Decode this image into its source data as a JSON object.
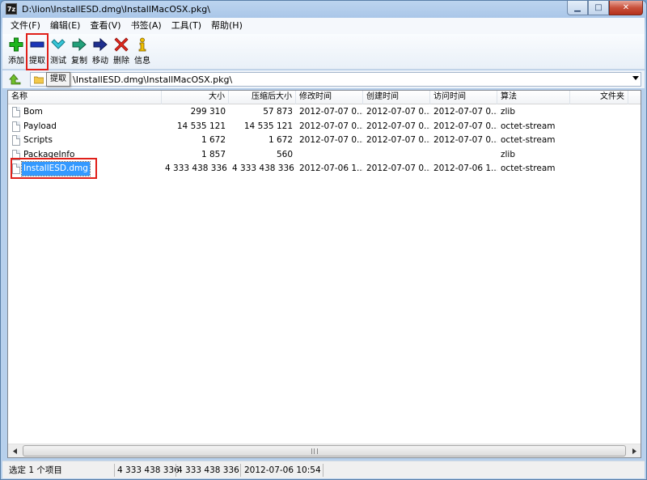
{
  "window": {
    "title": "D:\\lion\\InstallESD.dmg\\InstallMacOSX.pkg\\",
    "app_icon": "7z",
    "minimize": "▁",
    "maximize": "□",
    "close": "✕"
  },
  "menu": [
    "文件(F)",
    "编辑(E)",
    "查看(V)",
    "书签(A)",
    "工具(T)",
    "帮助(H)"
  ],
  "toolbar": [
    {
      "label": "添加",
      "icon": "add-icon"
    },
    {
      "label": "提取",
      "icon": "extract-icon"
    },
    {
      "label": "测试",
      "icon": "test-icon"
    },
    {
      "label": "复制",
      "icon": "copy-icon"
    },
    {
      "label": "移动",
      "icon": "move-icon"
    },
    {
      "label": "删除",
      "icon": "delete-icon"
    },
    {
      "label": "信息",
      "icon": "info-icon"
    }
  ],
  "tooltip": "提取",
  "address": "\\InstallESD.dmg\\InstallMacOSX.pkg\\",
  "columns": [
    "名称",
    "大小",
    "压缩后大小",
    "修改时间",
    "创建时间",
    "访问时间",
    "算法",
    "文件夹"
  ],
  "files": [
    {
      "name": "Bom",
      "size": "299 310",
      "packed": "57 873",
      "modified": "2012-07-07 0...",
      "created": "2012-07-07 0...",
      "accessed": "2012-07-07 0...",
      "method": "zlib"
    },
    {
      "name": "Payload",
      "size": "14 535 121",
      "packed": "14 535 121",
      "modified": "2012-07-07 0...",
      "created": "2012-07-07 0...",
      "accessed": "2012-07-07 0...",
      "method": "octet-stream"
    },
    {
      "name": "Scripts",
      "size": "1 672",
      "packed": "1 672",
      "modified": "2012-07-07 0...",
      "created": "2012-07-07 0...",
      "accessed": "2012-07-07 0...",
      "method": "octet-stream"
    },
    {
      "name": "PackageInfo",
      "size": "1 857",
      "packed": "560",
      "modified": "",
      "created": "",
      "accessed": "",
      "method": "zlib"
    },
    {
      "name": "InstallESD.dmg",
      "size": "4 333 438 336",
      "packed": "4 333 438 336",
      "modified": "2012-07-06 1...",
      "created": "2012-07-07 0...",
      "accessed": "2012-07-06 1...",
      "method": "octet-stream"
    }
  ],
  "selected_index": 4,
  "status": {
    "selection": "选定 1 个项目",
    "size": "4 333 438 336",
    "packed": "4 333 438 336",
    "modified": "2012-07-06 10:54"
  }
}
